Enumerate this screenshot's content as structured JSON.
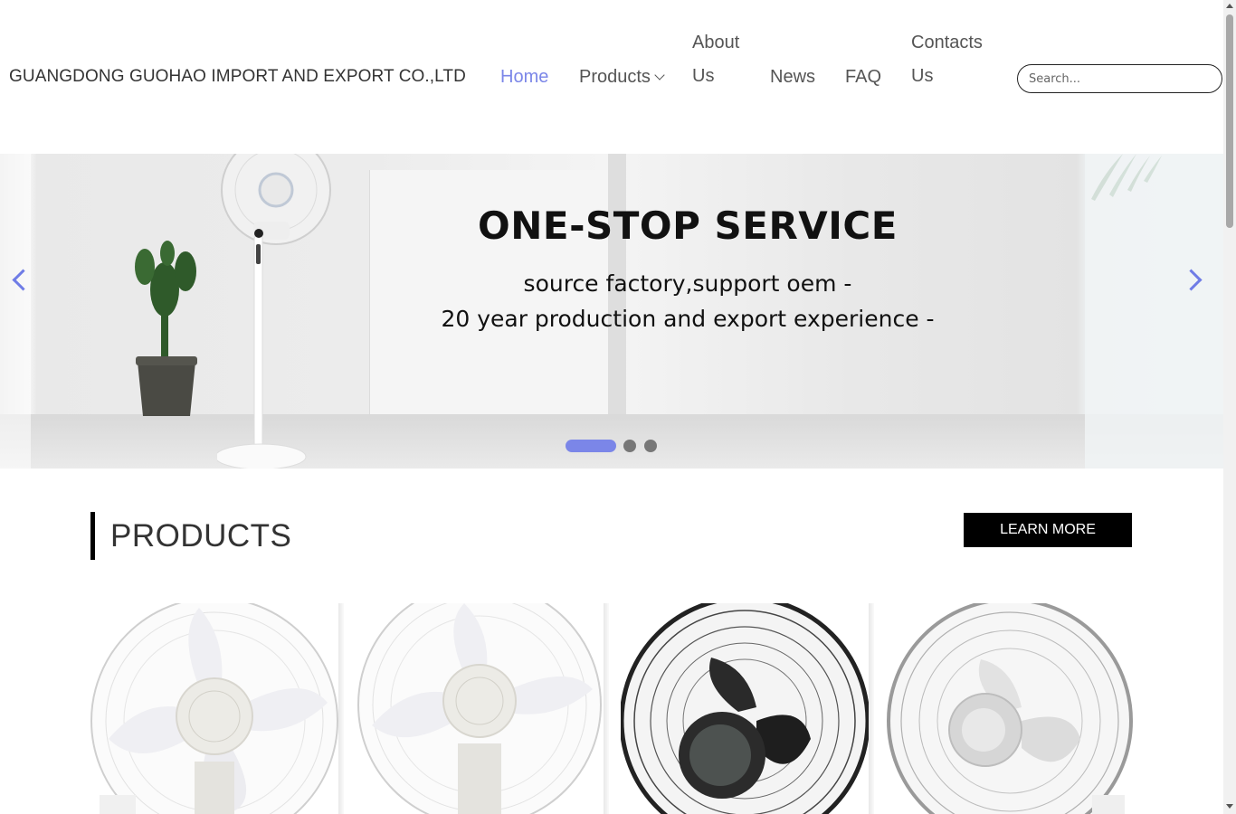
{
  "header": {
    "brand": "GUANGDONG GUOHAO IMPORT AND EXPORT CO.,LTD",
    "nav": {
      "home": "Home",
      "products": "Products",
      "about": "About Us",
      "news": "News",
      "faq": "FAQ",
      "contacts": "Contacts Us"
    },
    "search_placeholder": "Search..."
  },
  "banner": {
    "title": "ONE-STOP SERVICE",
    "line1": "source factory,support oem -",
    "line2": "20 year production and export experience -",
    "active_slide": 1,
    "slide_count": 3
  },
  "products": {
    "heading": "PRODUCTS",
    "learn_more": "LEARN MORE",
    "items": [
      {
        "icon": "white-stand-fan-image"
      },
      {
        "icon": "white-stand-fan-image"
      },
      {
        "icon": "black-stand-fan-image"
      },
      {
        "icon": "silver-stand-fan-image"
      }
    ]
  },
  "colors": {
    "accent": "#7b86e8",
    "text": "#333333",
    "button_bg": "#000000",
    "button_text": "#ffffff"
  }
}
